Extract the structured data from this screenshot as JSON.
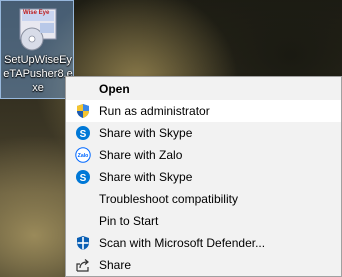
{
  "desktop_icon": {
    "label": "SetUpWiseEyeTAPusher8.exe",
    "logo_text": "Wise Eye"
  },
  "context_menu": {
    "items": [
      {
        "label": "Open",
        "icon": "none"
      },
      {
        "label": "Run as administrator",
        "icon": "uac-shield-icon"
      },
      {
        "label": "Share with Skype",
        "icon": "skype-icon"
      },
      {
        "label": "Share with Zalo",
        "icon": "zalo-icon"
      },
      {
        "label": "Share with Skype",
        "icon": "skype-icon"
      },
      {
        "label": "Troubleshoot compatibility",
        "icon": "none"
      },
      {
        "label": "Pin to Start",
        "icon": "none"
      },
      {
        "label": "Scan with Microsoft Defender...",
        "icon": "defender-icon"
      },
      {
        "label": "Share",
        "icon": "share-icon"
      }
    ]
  },
  "colors": {
    "selection": "#78aae6",
    "menu_bg": "#f2f2f2",
    "skype_blue": "#0078d7",
    "zalo_blue": "#0068ff"
  }
}
